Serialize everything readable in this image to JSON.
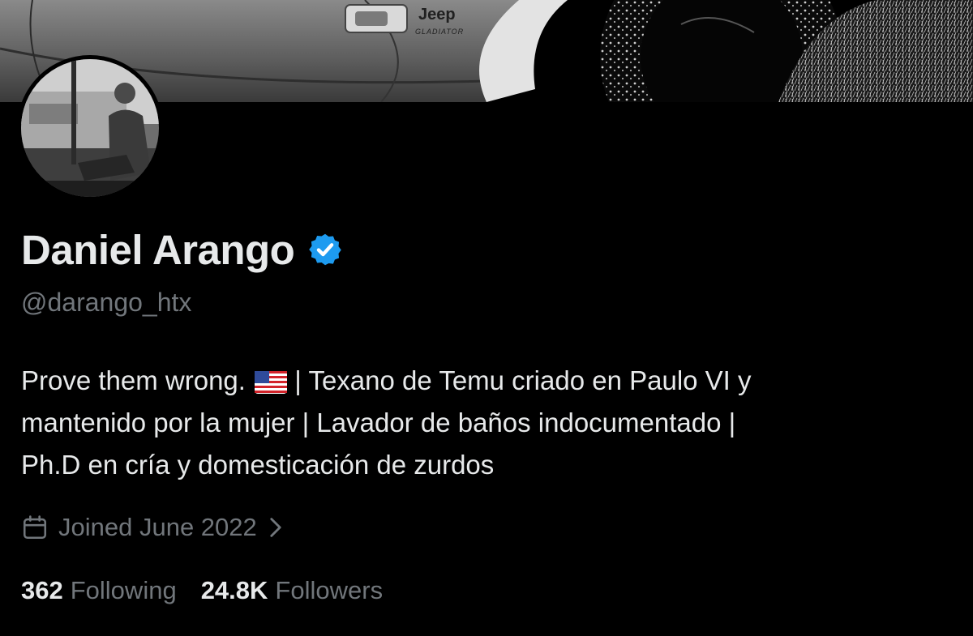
{
  "banner": {
    "brand": "Jeep",
    "model": "GLADIATOR"
  },
  "profile": {
    "name": "Daniel Arango",
    "handle": "@darango_htx",
    "verified": true,
    "bio_lines": [
      "Prove them wrong.",
      " | Texano de Temu criado en Paulo VI y",
      "mantenido por la mujer | Lavador de baños indocumentado |",
      "Ph.D en cría y domesticación de zurdos"
    ],
    "joined": "Joined June 2022",
    "following_count": "362",
    "following_label": "Following",
    "followers_count": "24.8K",
    "followers_label": "Followers"
  },
  "icons": {
    "verified": "verified-badge-icon",
    "flag": "us-flag-icon",
    "calendar": "calendar-icon",
    "chevron": "chevron-right-icon"
  },
  "colors": {
    "background": "#000000",
    "primary_text": "#e7e9ea",
    "secondary_text": "#71767b",
    "verified_blue": "#1d9bf0"
  }
}
